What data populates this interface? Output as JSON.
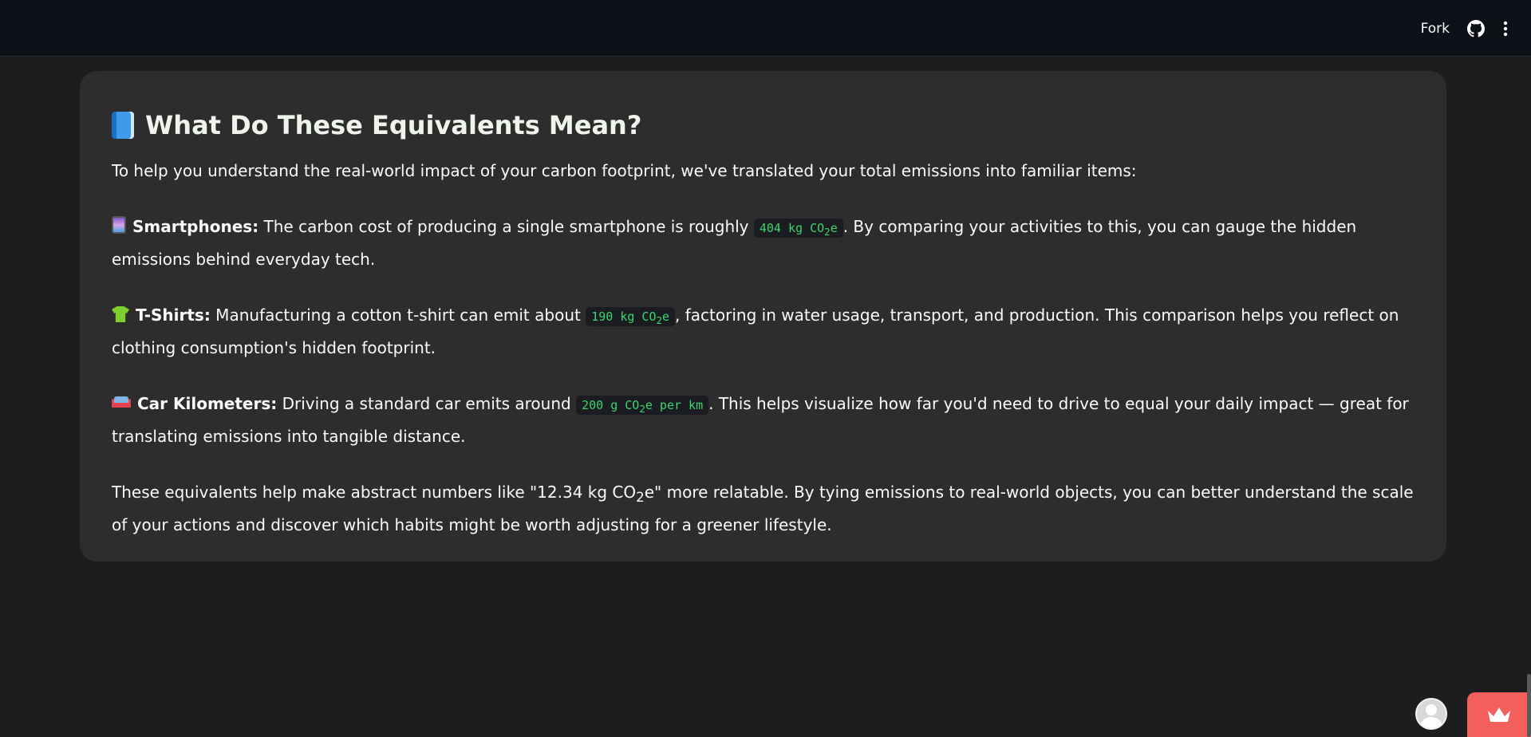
{
  "header": {
    "fork_label": "Fork",
    "github_icon": "github-icon",
    "menu_icon": "kebab-menu-icon"
  },
  "card": {
    "title_icon": "blue-book-icon",
    "title": "What Do These Equivalents Mean?",
    "intro": "To help you understand the real-world impact of your carbon footprint, we've translated your total emissions into familiar items:",
    "items": [
      {
        "icon": "mobile-phone-icon",
        "label": "Smartphones:",
        "before": " The carbon cost of producing a single smartphone is roughly ",
        "code_prefix": "404 kg CO",
        "code_sub": "2",
        "code_suffix": "e",
        "after": ". By comparing your activities to this, you can gauge the hidden emissions behind everyday tech."
      },
      {
        "icon": "t-shirt-icon",
        "label": "T-Shirts:",
        "before": " Manufacturing a cotton t-shirt can emit about ",
        "code_prefix": "190 kg CO",
        "code_sub": "2",
        "code_suffix": "e",
        "after": ", factoring in water usage, transport, and production. This comparison helps you reflect on clothing consumption's hidden footprint."
      },
      {
        "icon": "car-icon",
        "label": "Car Kilometers:",
        "before": " Driving a standard car emits around ",
        "code_prefix": "200 g CO",
        "code_sub": "2",
        "code_suffix": "e per km",
        "after": ". This helps visualize how far you'd need to drive to equal your daily impact — great for translating emissions into tangible distance."
      }
    ],
    "closing_prefix": "These equivalents help make abstract numbers like \"12.34 kg CO",
    "closing_sub": "2",
    "closing_suffix": "e\" more relatable. By tying emissions to real-world objects, you can better understand the scale of your actions and discover which habits might be worth adjusting for a greener lifestyle."
  },
  "footer": {
    "avatar_icon": "user-avatar-icon",
    "crown_icon": "crown-icon"
  },
  "colors": {
    "background": "#1d1d1f",
    "topbar": "#0e1117",
    "card": "#2d2d2d",
    "code_text": "#3dd56d",
    "accent_button": "#f25f5c"
  }
}
